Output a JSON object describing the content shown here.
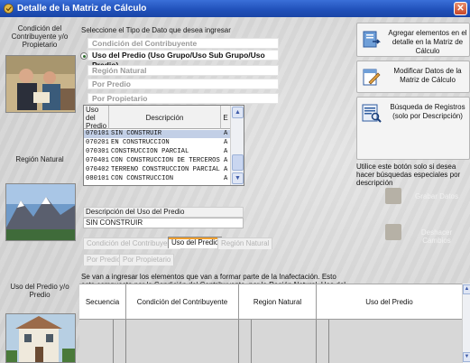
{
  "window": {
    "title": "Detalle de la Matriz de Cálculo",
    "close_symbol": "✕"
  },
  "left_panel": {
    "condicion_caption": "Condición del Contribuyente y/o Propietario",
    "region_caption": "Región Natural",
    "uso_caption": "Uso del Predio y/o Predio"
  },
  "selector": {
    "prompt": "Seleccione el Tipo de Dato que desea ingresar",
    "options": [
      "Condición del Contribuyente",
      "Uso del Predio (Uso Grupo/Uso Sub Grupo/Uso Predio)",
      "Región Natural",
      "Por Predio",
      "Por Propietario"
    ],
    "selected_index": 1
  },
  "uso_grid": {
    "headers": [
      "Uso del Predio",
      "Descripción",
      "E"
    ],
    "rows": [
      [
        "070101",
        "SIN CONSTRUIR",
        "A"
      ],
      [
        "070201",
        "EN CONSTRUCCION",
        "A"
      ],
      [
        "070301",
        "CONSTRUCCION PARCIAL",
        "A"
      ],
      [
        "070401",
        "CON CONSTRUCCION DE TERCEROS",
        "A"
      ],
      [
        "070402",
        "TERRENO CONSTRUCCION PARCIAL",
        "A"
      ],
      [
        "080101",
        "CON CONSTRUCCION",
        "A"
      ]
    ],
    "selected_row": 0,
    "scroll_up": "▲",
    "scroll_down": "▼"
  },
  "description": {
    "label": "Descripción del Uso del Predio",
    "value": "SIN CONSTRUIR"
  },
  "tabs": {
    "row1": [
      "Condición del Contribuyente",
      "Uso del Predio",
      "Región Natural"
    ],
    "row2": [
      "Por Predio",
      "Por Propietario"
    ],
    "active": "Uso del Predio"
  },
  "note": "Se van a ingresar los elementos que van a formar parte de la Inafectación. Esto esta compuesto por la Condición del Contribuyente, por la Región Natural, Uso del Predio, Propietario y Predio.",
  "actions": {
    "add_label": "Agregar elementos en el detalle en la Matriz de Cálculo",
    "modify_label": "Modificar Datos de la Matriz de Cálculo",
    "search_label": "Búsqueda de Registros (solo por Descripción)",
    "hint": "Utilice este botón solo si desea hacer búsquedas especiales por descripción",
    "save_label": "Grabar Datos",
    "undo_label": "Deshacer Cambios"
  },
  "bottom_grid": {
    "headers": [
      "Secuencia",
      "Condición del Contribuyente",
      "Region Natural",
      "Uso del Predio"
    ]
  },
  "colors": {
    "titlebar": "#1f4fb8",
    "selection": "#c2cfe6",
    "active_tab_accent": "#f0a030"
  }
}
